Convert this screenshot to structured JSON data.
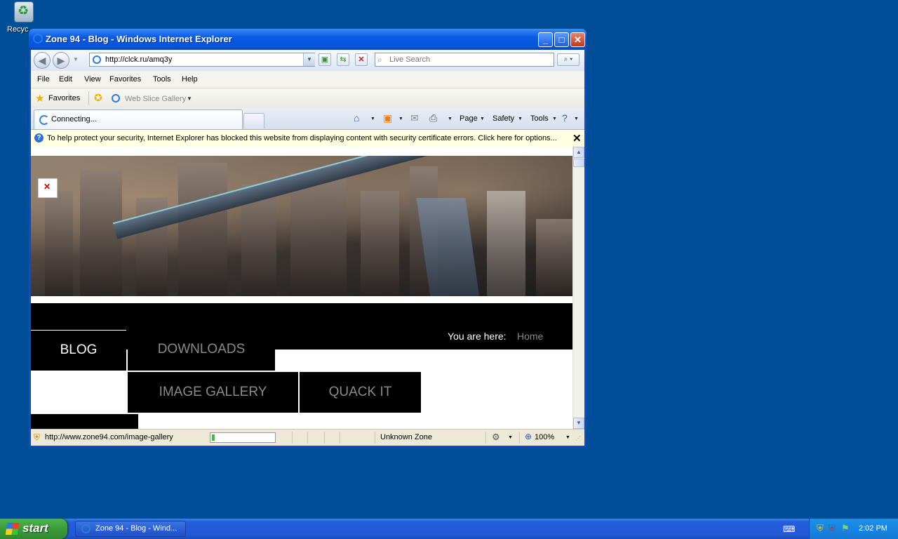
{
  "desktop": {
    "recycle_label": "Recyc"
  },
  "window": {
    "title": "Zone 94 - Blog - Windows Internet Explorer",
    "address": "http://clck.ru/amq3y",
    "search_placeholder": "Live Search",
    "menu": [
      "File",
      "Edit",
      "View",
      "Favorites",
      "Tools",
      "Help"
    ],
    "favorites_label": "Favorites",
    "web_slice_label": "Web Slice Gallery",
    "tab_title": "Connecting...",
    "command_bar": {
      "page": "Page",
      "safety": "Safety",
      "tools": "Tools"
    },
    "info_bar": "To help protect your security, Internet Explorer has blocked this website from displaying content with security certificate errors. Click here for options...",
    "status": {
      "url": "http://www.zone94.com/image-gallery",
      "zone": "Unknown Zone",
      "zoom": "100%",
      "progress": 0.05
    }
  },
  "page": {
    "breadcrumb_label": "You are here:",
    "breadcrumb_home": "Home",
    "nav": {
      "blog": "BLOG",
      "downloads": "DOWNLOADS",
      "gallery": "IMAGE GALLERY",
      "quack": "QUACK IT"
    }
  },
  "taskbar": {
    "start_label": "start",
    "task_item": "Zone 94 - Blog - Wind...",
    "clock": "2:02 PM"
  },
  "colors": {
    "desktop": "#004e98",
    "taskbar": "#245edb",
    "start": "#3b9a3b"
  }
}
